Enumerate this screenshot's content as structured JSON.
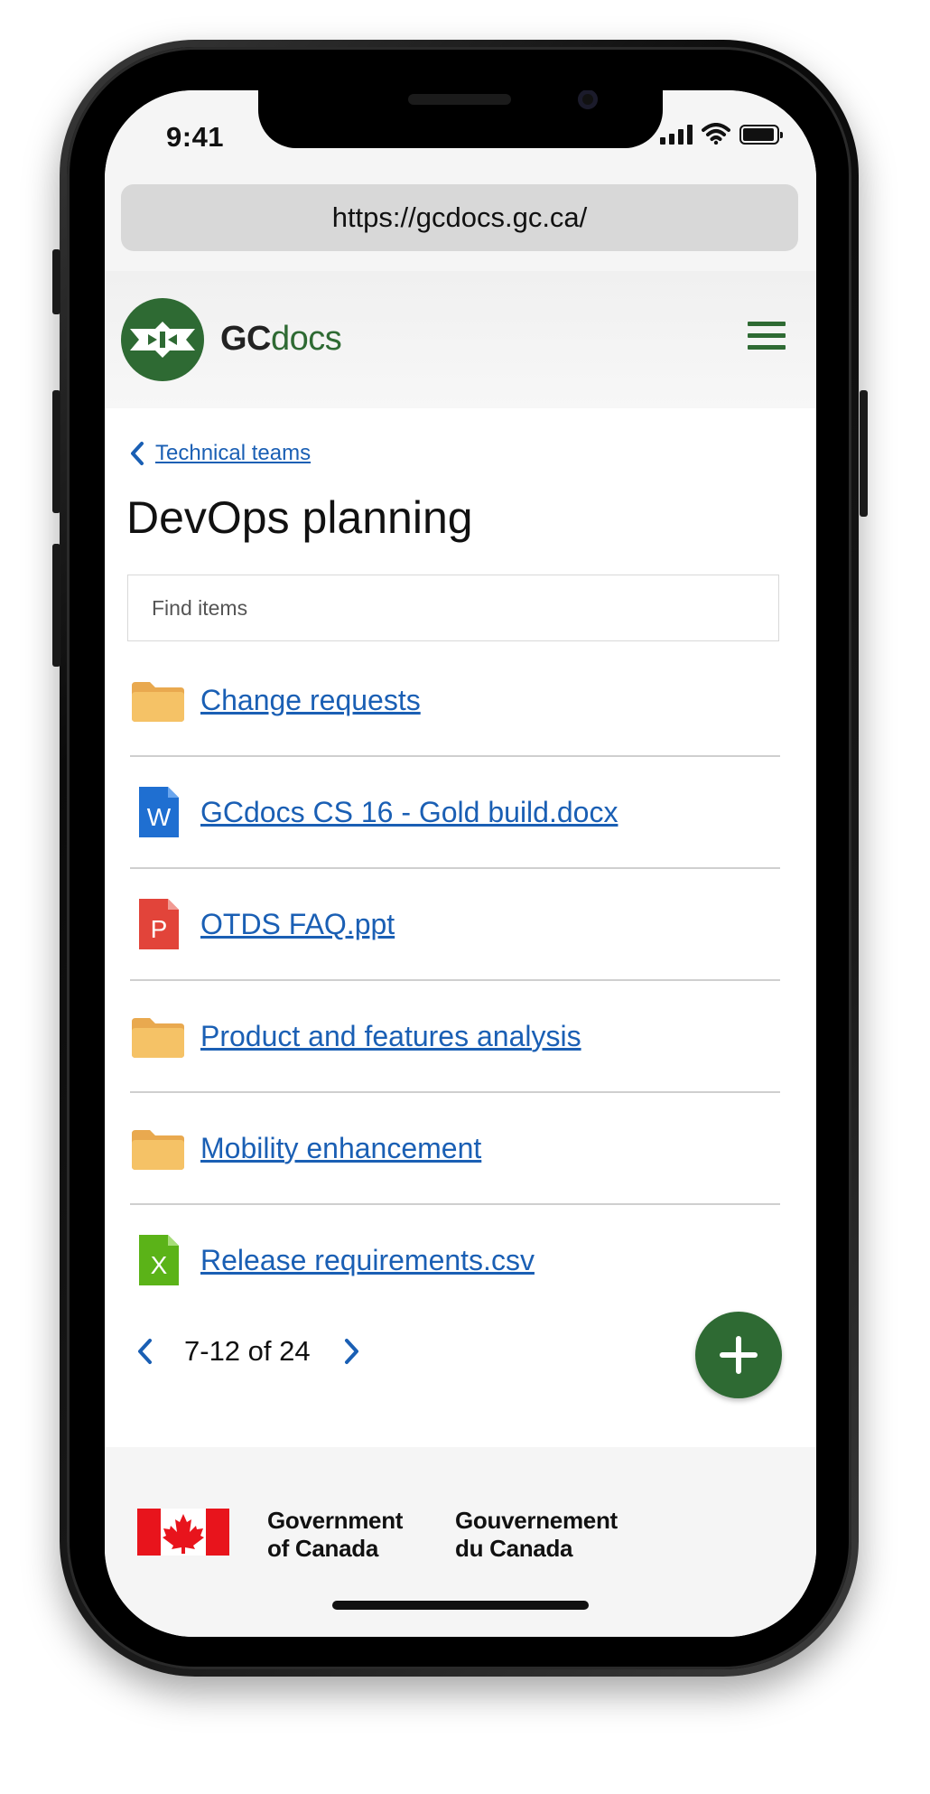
{
  "status_bar": {
    "time": "9:41"
  },
  "browser": {
    "url": "https://gcdocs.gc.ca/"
  },
  "site_header": {
    "brand_prefix": "GC",
    "brand_suffix": "docs"
  },
  "breadcrumb": {
    "parent_label": "Technical teams"
  },
  "page": {
    "title": "DevOps planning"
  },
  "search": {
    "placeholder": "Find items"
  },
  "items": [
    {
      "label": "Change requests",
      "type": "folder",
      "icon": "folder-icon"
    },
    {
      "label": "GCdocs CS 16 - Gold build.docx",
      "type": "word",
      "icon": "word-doc-icon",
      "glyph": "W",
      "color": "#1f6fd1"
    },
    {
      "label": "OTDS FAQ.ppt",
      "type": "powerpoint",
      "icon": "powerpoint-doc-icon",
      "glyph": "P",
      "color": "#e2443a"
    },
    {
      "label": "Product and features analysis",
      "type": "folder",
      "icon": "folder-icon"
    },
    {
      "label": "Mobility enhancement",
      "type": "folder",
      "icon": "folder-icon"
    },
    {
      "label": "Release requirements.csv",
      "type": "excel",
      "icon": "excel-doc-icon",
      "glyph": "X",
      "color": "#5bb318"
    }
  ],
  "pagination": {
    "range_text": "7-12 of 24"
  },
  "footer": {
    "gov_en_line1": "Government",
    "gov_en_line2": "of Canada",
    "gov_fr_line1": "Gouvernement",
    "gov_fr_line2": "du Canada"
  },
  "colors": {
    "brand_green": "#2e6a33",
    "link_blue": "#1a5fb4",
    "flag_red": "#e8141c",
    "folder": "#f5c266"
  }
}
